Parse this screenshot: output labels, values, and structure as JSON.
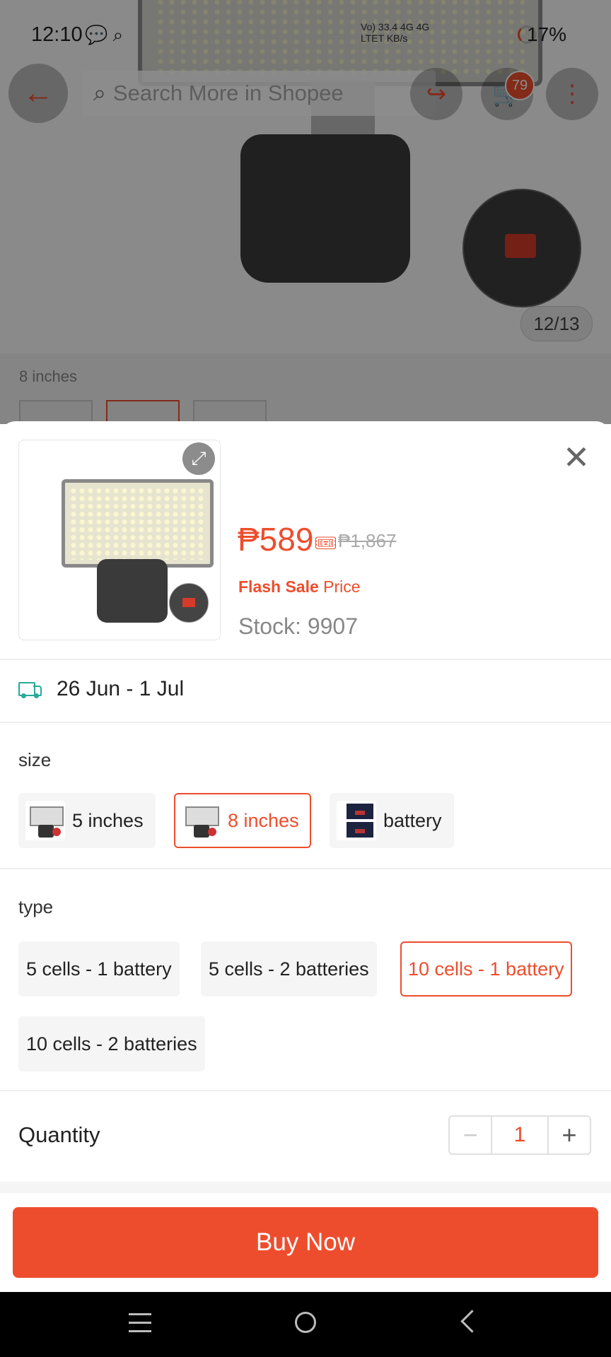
{
  "status_bar": {
    "time": "12:10",
    "network_line1": "Vo) 33.4 4G 4G",
    "network_line2": "LTET KB/s",
    "battery": "17%"
  },
  "top_nav": {
    "search_placeholder": "Search More in Shopee",
    "cart_count": "79"
  },
  "gallery": {
    "counter": "12/13",
    "variant_label": "8 inches"
  },
  "sheet": {
    "price": "₱589",
    "original_price": "₱1,867",
    "flash_sale": "Flash Sale",
    "flash_price_word": "Price",
    "stock": "Stock: 9907",
    "delivery": "26 Jun - 1 Jul",
    "size": {
      "title": "size",
      "options": [
        {
          "label": "5 inches",
          "selected": false
        },
        {
          "label": "8 inches",
          "selected": true
        },
        {
          "label": "battery",
          "selected": false
        }
      ]
    },
    "type": {
      "title": "type",
      "options": [
        {
          "label": "5 cells - 1 battery",
          "selected": false
        },
        {
          "label": "5 cells - 2 batteries",
          "selected": false
        },
        {
          "label": "10 cells - 1 battery",
          "selected": true
        },
        {
          "label": "10 cells - 2 batteries",
          "selected": false
        }
      ]
    },
    "quantity": {
      "label": "Quantity",
      "minus": "−",
      "value": "1",
      "plus": "+"
    },
    "buy_now": "Buy Now"
  },
  "colors": {
    "accent": "#ee4d2d",
    "delivery_icon": "#26aa99"
  },
  "icons": [
    "back-arrow-icon",
    "search-icon",
    "share-icon",
    "cart-icon",
    "more-icon",
    "expand-icon",
    "close-icon",
    "voucher-icon",
    "truck-icon",
    "menu-icon",
    "home-icon",
    "back-nav-icon"
  ]
}
